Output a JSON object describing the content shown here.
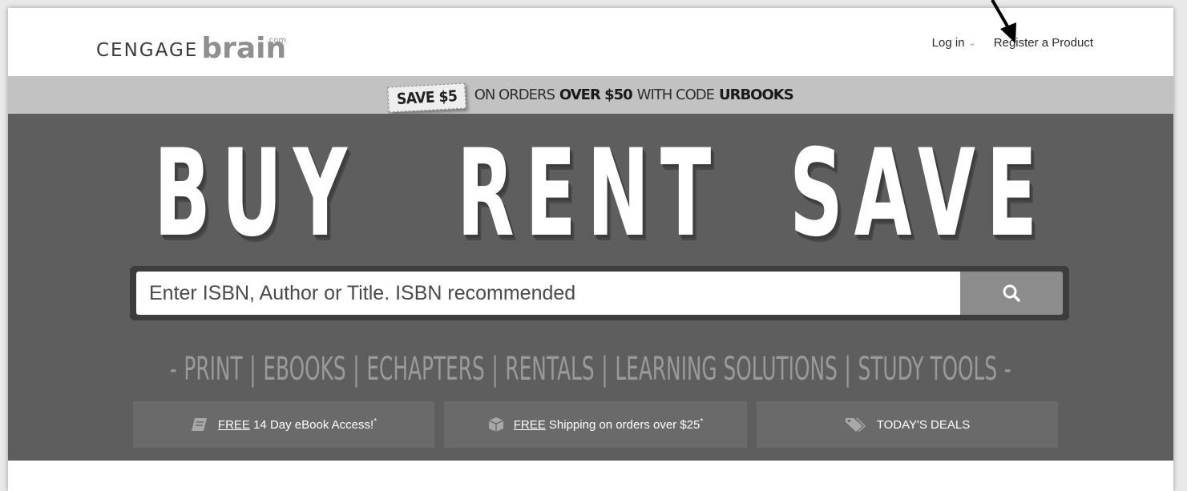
{
  "header": {
    "logo_prefix": "CENGAGE",
    "logo_brand": "brain",
    "logo_suffix": ".com",
    "login_label": "Log in",
    "register_label": "Register a Product"
  },
  "promo": {
    "tag": "SAVE $5",
    "text_1": "ON ORDERS",
    "text_2": "OVER $50",
    "text_3": "WITH CODE",
    "code": "URBOOKS"
  },
  "hero": {
    "words": [
      "BUY",
      "RENT",
      "SAVE"
    ]
  },
  "search": {
    "placeholder": "Enter ISBN, Author or Title. ISBN recommended"
  },
  "categories": {
    "dash": "-",
    "separator": "|",
    "items": [
      "PRINT",
      "EBOOKS",
      "ECHAPTERS",
      "RENTALS",
      "LEARNING SOLUTIONS",
      "STUDY TOOLS"
    ]
  },
  "features": [
    {
      "free": "FREE",
      "label": "14 Day eBook Access!",
      "star": "*",
      "icon": "ebook-icon"
    },
    {
      "free": "FREE",
      "label": "Shipping on orders over $25",
      "star": "*",
      "icon": "box-icon"
    },
    {
      "label": "TODAY'S DEALS",
      "icon": "tag-icon"
    }
  ],
  "colors": {
    "hero_bg": "#5e5e5e",
    "promo_bg": "#c2c2c2",
    "feature_bg": "#6a6a6a",
    "search_button": "#8c8c8c"
  }
}
